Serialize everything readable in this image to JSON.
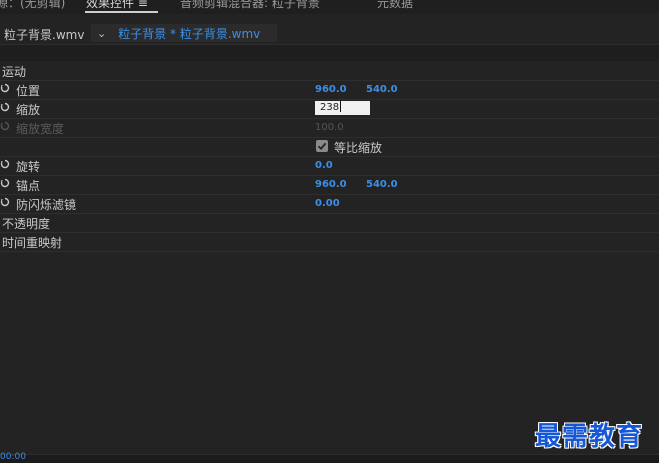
{
  "tabs": [
    {
      "label": "源：(无剪辑)"
    },
    {
      "label": "效果控件 ≡"
    },
    {
      "label": "音频剪辑混合器: 粒子背景"
    },
    {
      "label": "元数据"
    }
  ],
  "clip": {
    "source_label": "粒子背景.wmv",
    "sequence_label": "粒子背景 * 粒子背景.wmv"
  },
  "properties": {
    "motion": {
      "label": "运动"
    },
    "position": {
      "label": "位置",
      "x": "960.0",
      "y": "540.0"
    },
    "scale": {
      "label": "缩放",
      "value": "238"
    },
    "scale_width": {
      "label": "缩放宽度",
      "value": "100.0"
    },
    "uniform_scale": {
      "label": "等比缩放",
      "checked": true
    },
    "rotation": {
      "label": "旋转",
      "value": "0.0"
    },
    "anchor": {
      "label": "锚点",
      "x": "960.0",
      "y": "540.0"
    },
    "anti_flicker": {
      "label": "防闪烁滤镜",
      "value": "0.00"
    },
    "opacity": {
      "label": "不透明度"
    },
    "time_remap": {
      "label": "时间重映射"
    }
  },
  "bottom": {
    "timecode": "00:00"
  },
  "watermark": {
    "text": "最需教育"
  },
  "colors": {
    "value_blue": "#3d8ee6",
    "background": "#232323",
    "watermark_blue": "#1557d6"
  },
  "icons": {
    "stopwatch": "stopwatch-icon",
    "chevron": "chevron-down-icon",
    "checkbox": "checkmark-icon"
  }
}
